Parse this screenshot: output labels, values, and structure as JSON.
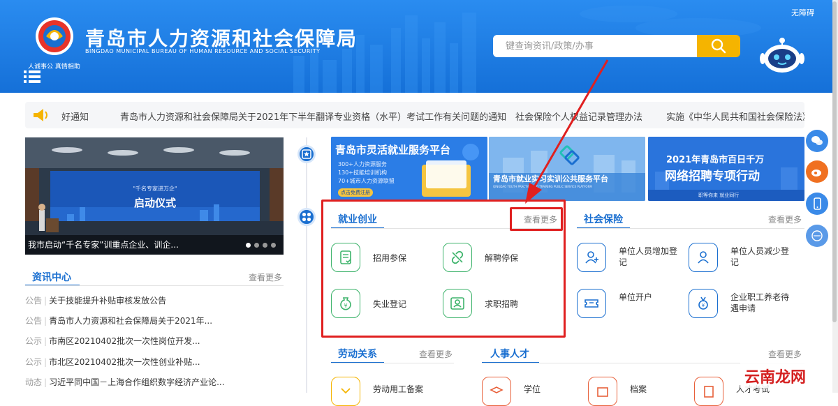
{
  "header": {
    "logo_caption": "人诚事公  真情相助",
    "title": "青岛市人力资源和社会保障局",
    "subtitle": "BINGDAO MUNICIPAL BUREAU OF HUMAN RESOURCE AND SOCIAL SECURITY",
    "top_link": "无障碍",
    "search_placeholder": "键查询资讯/政策/办事"
  },
  "notices": [
    "好通知",
    "青岛市人力资源和社会保障局关于2021年下半年翻译专业资格（水平）考试工作有关问题的通知",
    "社会保险个人权益记录管理办法",
    "实施《中华人民共和国社会保险法》"
  ],
  "banner": {
    "caption": "我市启动“千名专家”训重点企业、训企...",
    "slide_text": "启动仪式"
  },
  "news": {
    "title": "资讯中心",
    "more": "查看更多",
    "items": [
      {
        "cat": "公告",
        "title": "关于技能提升补贴审核发放公告"
      },
      {
        "cat": "公告",
        "title": "青岛市人力资源和社会保障局关于2021年..."
      },
      {
        "cat": "公示",
        "title": "市南区20210402批次一次性岗位开发..."
      },
      {
        "cat": "公示",
        "title": "市北区20210402批次一次性创业补贴..."
      },
      {
        "cat": "动态",
        "title": "习近平同中国－上海合作组织数字经济产业论..."
      }
    ]
  },
  "promos": {
    "p1": {
      "title": "青岛市灵活就业服务平台",
      "lines": [
        "300+人力资源服务",
        "130+技能培训机构",
        "70+城市人力资源联盟"
      ],
      "cta": "点击免费注册"
    },
    "p2": {
      "title": "青岛市就业实习实训公共服务平台",
      "sub": "QINGDAO YOUTH PRACTICE AND TRAINING PUBLIC SERVICE PLATFORM"
    },
    "p3": {
      "title1": "2021年青岛市百日千万",
      "title2": "网络招聘专项行动",
      "sub": "职等你来  就业同行"
    }
  },
  "employment": {
    "title": "就业创业",
    "more": "查看更多",
    "items": [
      "招用参保",
      "解聘停保",
      "失业登记",
      "求职招聘"
    ]
  },
  "social": {
    "title": "社会保险",
    "more": "查看更多",
    "items": [
      "单位人员增加登记",
      "单位人员减少登记",
      "单位开户",
      "企业职工养老待遇申请"
    ]
  },
  "labor": {
    "title": "劳动关系",
    "more": "查看更多",
    "items": [
      "劳动用工备案"
    ]
  },
  "talent": {
    "title": "人事人才",
    "more": "查看更多",
    "items": [
      "学位",
      "档案",
      "人才考试"
    ]
  },
  "watermark": "云南龙网",
  "colors": {
    "primary": "#1a7ce8",
    "accent": "#f5b400",
    "highlight": "#e02020",
    "green": "#3db36b"
  }
}
